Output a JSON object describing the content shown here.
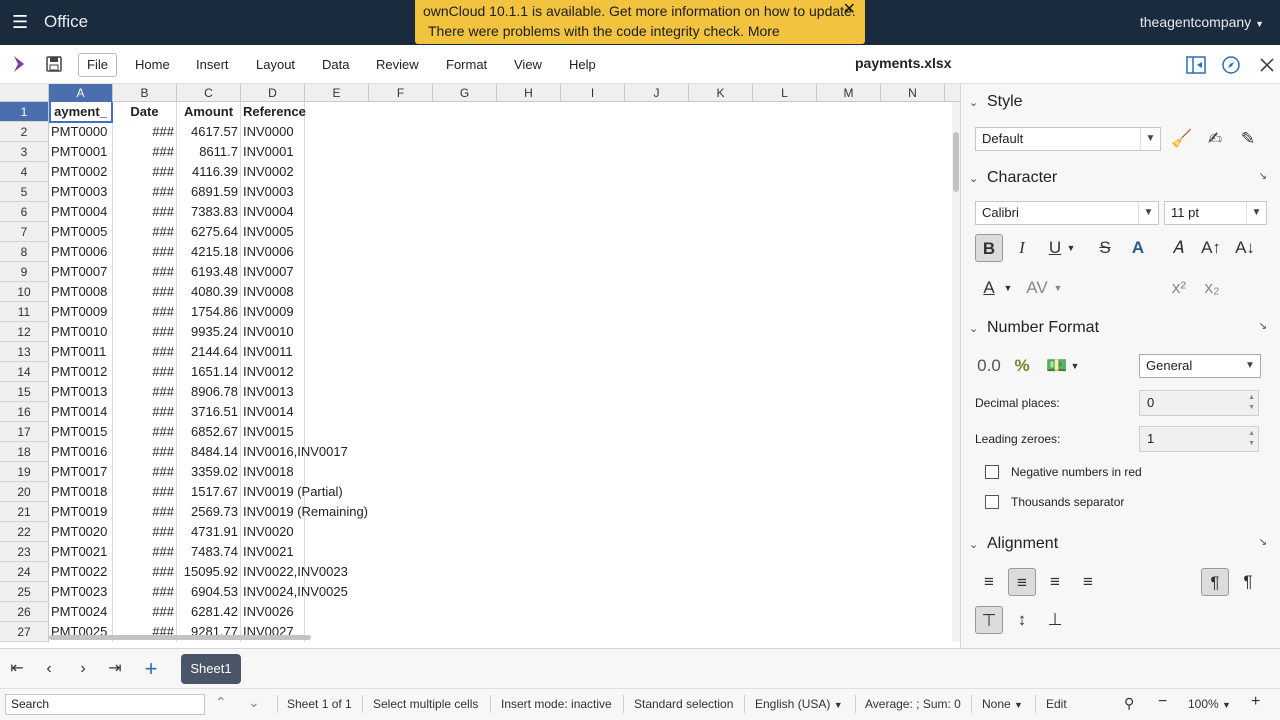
{
  "appbar": {
    "app_name": "Office",
    "notice_line1": "ownCloud 10.1.1 is available. Get more information on how to update.",
    "notice_line2": "There were problems with the code integrity check. More information…",
    "user": "theagentcompany"
  },
  "menubar": {
    "tabs": [
      "File",
      "Home",
      "Insert",
      "Layout",
      "Data",
      "Review",
      "Format",
      "View",
      "Help"
    ],
    "active_tab": "File",
    "filename": "payments.xlsx"
  },
  "grid": {
    "columns": [
      "A",
      "B",
      "C",
      "D",
      "E",
      "F",
      "G",
      "H",
      "I",
      "J",
      "K",
      "L",
      "M",
      "N"
    ],
    "selected_column": "A",
    "selected_row": 1,
    "header": [
      "ayment_",
      "Date",
      "Amount",
      "Reference"
    ],
    "rows": [
      {
        "n": "2",
        "a": "PMT0000",
        "b": "###",
        "c": "4617.57",
        "d": "INV0000"
      },
      {
        "n": "3",
        "a": "PMT0001",
        "b": "###",
        "c": "8611.7",
        "d": "INV0001"
      },
      {
        "n": "4",
        "a": "PMT0002",
        "b": "###",
        "c": "4116.39",
        "d": "INV0002"
      },
      {
        "n": "5",
        "a": "PMT0003",
        "b": "###",
        "c": "6891.59",
        "d": "INV0003"
      },
      {
        "n": "6",
        "a": "PMT0004",
        "b": "###",
        "c": "7383.83",
        "d": "INV0004"
      },
      {
        "n": "7",
        "a": "PMT0005",
        "b": "###",
        "c": "6275.64",
        "d": "INV0005"
      },
      {
        "n": "8",
        "a": "PMT0006",
        "b": "###",
        "c": "4215.18",
        "d": "INV0006"
      },
      {
        "n": "9",
        "a": "PMT0007",
        "b": "###",
        "c": "6193.48",
        "d": "INV0007"
      },
      {
        "n": "10",
        "a": "PMT0008",
        "b": "###",
        "c": "4080.39",
        "d": "INV0008"
      },
      {
        "n": "11",
        "a": "PMT0009",
        "b": "###",
        "c": "1754.86",
        "d": "INV0009"
      },
      {
        "n": "12",
        "a": "PMT0010",
        "b": "###",
        "c": "9935.24",
        "d": "INV0010"
      },
      {
        "n": "13",
        "a": "PMT0011",
        "b": "###",
        "c": "2144.64",
        "d": "INV0011"
      },
      {
        "n": "14",
        "a": "PMT0012",
        "b": "###",
        "c": "1651.14",
        "d": "INV0012"
      },
      {
        "n": "15",
        "a": "PMT0013",
        "b": "###",
        "c": "8906.78",
        "d": "INV0013"
      },
      {
        "n": "16",
        "a": "PMT0014",
        "b": "###",
        "c": "3716.51",
        "d": "INV0014"
      },
      {
        "n": "17",
        "a": "PMT0015",
        "b": "###",
        "c": "6852.67",
        "d": "INV0015"
      },
      {
        "n": "18",
        "a": "PMT0016",
        "b": "###",
        "c": "8484.14",
        "d": "INV0016,INV0017"
      },
      {
        "n": "19",
        "a": "PMT0017",
        "b": "###",
        "c": "3359.02",
        "d": "INV0018"
      },
      {
        "n": "20",
        "a": "PMT0018",
        "b": "###",
        "c": "1517.67",
        "d": "INV0019 (Partial)"
      },
      {
        "n": "21",
        "a": "PMT0019",
        "b": "###",
        "c": "2569.73",
        "d": "INV0019 (Remaining)"
      },
      {
        "n": "22",
        "a": "PMT0020",
        "b": "###",
        "c": "4731.91",
        "d": "INV0020"
      },
      {
        "n": "23",
        "a": "PMT0021",
        "b": "###",
        "c": "7483.74",
        "d": "INV0021"
      },
      {
        "n": "24",
        "a": "PMT0022",
        "b": "###",
        "c": "15095.92",
        "d": "INV0022,INV0023"
      },
      {
        "n": "25",
        "a": "PMT0023",
        "b": "###",
        "c": "6904.53",
        "d": "INV0024,INV0025"
      },
      {
        "n": "26",
        "a": "PMT0024",
        "b": "###",
        "c": "6281.42",
        "d": "INV0026"
      },
      {
        "n": "27",
        "a": "PMT0025",
        "b": "###",
        "c": "9281.77",
        "d": "INV0027"
      }
    ]
  },
  "sidebar": {
    "style": {
      "title": "Style",
      "value": "Default"
    },
    "character": {
      "title": "Character",
      "font": "Calibri",
      "size": "11 pt"
    },
    "number_format": {
      "title": "Number Format",
      "format": "General",
      "decimal_label": "Decimal places:",
      "decimal_value": "0",
      "leading_label": "Leading zeroes:",
      "leading_value": "1",
      "neg_red_label": "Negative numbers in red",
      "thousands_label": "Thousands separator"
    },
    "alignment": {
      "title": "Alignment"
    }
  },
  "sheetbar": {
    "sheet_name": "Sheet1"
  },
  "statusbar": {
    "search_placeholder": "Search",
    "sheet_info": "Sheet 1 of 1",
    "selection_mode": "Select multiple cells",
    "insert_mode": "Insert mode: inactive",
    "selection_type": "Standard selection",
    "language": "English (USA)",
    "summary": "Average: ; Sum: 0",
    "none_label": "None",
    "edit_label": "Edit",
    "zoom": "100%"
  }
}
